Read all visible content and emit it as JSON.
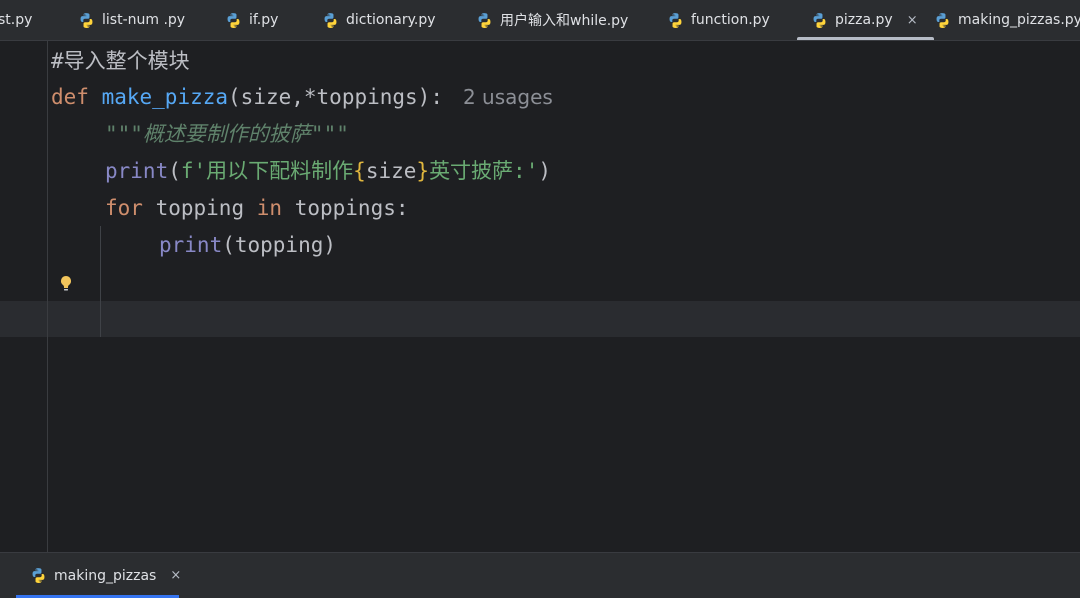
{
  "tabs": [
    {
      "label": "st.py",
      "icon": "python-file-icon"
    },
    {
      "label": "list-num .py",
      "icon": "python-file-icon"
    },
    {
      "label": "if.py",
      "icon": "python-file-icon"
    },
    {
      "label": "dictionary.py",
      "icon": "python-file-icon"
    },
    {
      "label": "用户输入和while.py",
      "icon": "python-file-icon"
    },
    {
      "label": "function.py",
      "icon": "python-file-icon"
    },
    {
      "label": "pizza.py",
      "icon": "python-file-icon",
      "active": true,
      "close": "×"
    },
    {
      "label": "making_pizzas.py",
      "icon": "python-file-icon"
    }
  ],
  "code": {
    "line1": "#导入整个模块",
    "line2": {
      "kw": "def",
      "fn": "make_pizza",
      "rest": "(size,*toppings):",
      "hint": "2 usages"
    },
    "line3": "\"\"\"概述要制作的披萨\"\"\"",
    "line4": {
      "builtin": "print",
      "open": "(",
      "fpre": "f'用以下配料制作",
      "lb": "{",
      "var": "size",
      "rb": "}",
      "fpost": "英寸披萨:'",
      "close": ")"
    },
    "line5": {
      "kw1": "for",
      "var": "topping",
      "kw2": "in",
      "iter": "toppings:"
    },
    "line6": {
      "builtin": "print",
      "args": "(topping)"
    }
  },
  "run": {
    "label": "making_pizzas",
    "close": "×"
  },
  "colors": {
    "keyword": "#cf8e6d",
    "function": "#56a8f5",
    "builtin": "#8888c6",
    "docstring": "#5f826b",
    "string": "#6aab73",
    "brace": "#e0b63e",
    "background": "#1e1f22",
    "accent": "#3574f0"
  }
}
